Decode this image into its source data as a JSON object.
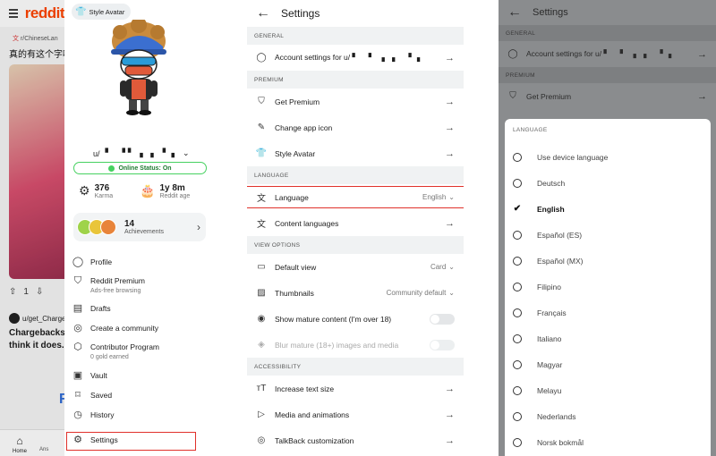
{
  "panel1": {
    "background": {
      "logo": "reddit",
      "subreddit": "r/ChineseLan",
      "post_title": "真的有这个字吗",
      "vote_count": "1",
      "post_user": "u/get_Charge",
      "post_text_1": "Chargebacks",
      "post_text_2": "think it does. L",
      "nav_home": "Home",
      "nav_second": "Ans"
    },
    "drawer": {
      "style_avatar_chip": "Style Avatar",
      "username": "u/",
      "online_status": "Online Status: On",
      "karma_value": "376",
      "karma_label": "Karma",
      "reddit_age_value": "1y 8m",
      "reddit_age_label": "Reddit age",
      "achievements_value": "14",
      "achievements_label": "Achievements",
      "menu": [
        {
          "label": "Profile",
          "icon": "user-icon"
        },
        {
          "label": "Reddit Premium",
          "sub": "Ads-free browsing",
          "icon": "shield-icon"
        },
        {
          "label": "Drafts",
          "icon": "drafts-icon"
        },
        {
          "label": "Create a community",
          "icon": "community-icon"
        },
        {
          "label": "Contributor Program",
          "sub": "0 gold earned",
          "icon": "gold-icon"
        },
        {
          "label": "Vault",
          "icon": "vault-icon"
        },
        {
          "label": "Saved",
          "icon": "bookmark-icon"
        },
        {
          "label": "History",
          "icon": "clock-icon"
        },
        {
          "label": "Settings",
          "icon": "gear-icon"
        }
      ]
    }
  },
  "panel2": {
    "title": "Settings",
    "sections": {
      "general": "GENERAL",
      "premium": "PREMIUM",
      "language": "LANGUAGE",
      "view_options": "VIEW OPTIONS",
      "accessibility": "ACCESSIBILITY"
    },
    "rows": {
      "account": "Account settings for u/",
      "get_premium": "Get Premium",
      "change_icon": "Change app icon",
      "style_avatar": "Style Avatar",
      "language": "Language",
      "language_value": "English",
      "content_languages": "Content languages",
      "default_view": "Default view",
      "default_view_value": "Card",
      "thumbnails": "Thumbnails",
      "thumbnails_value": "Community default",
      "mature": "Show mature content (I'm over 18)",
      "blur": "Blur mature (18+) images and media",
      "text_size": "Increase text size",
      "media": "Media and animations",
      "talkback": "TalkBack customization"
    }
  },
  "panel3": {
    "title": "Settings",
    "general": "GENERAL",
    "account": "Account settings for u/",
    "premium": "PREMIUM",
    "get_premium": "Get Premium",
    "sheet_title": "LANGUAGE",
    "selected": "English",
    "options": [
      "Use device language",
      "Deutsch",
      "English",
      "Español (ES)",
      "Español (MX)",
      "Filipino",
      "Français",
      "Italiano",
      "Magyar",
      "Melayu",
      "Nederlands",
      "Norsk bokmål"
    ]
  },
  "colors": {
    "brand": "#ff4500",
    "online": "#46d160",
    "highlight": "#e0312b"
  }
}
